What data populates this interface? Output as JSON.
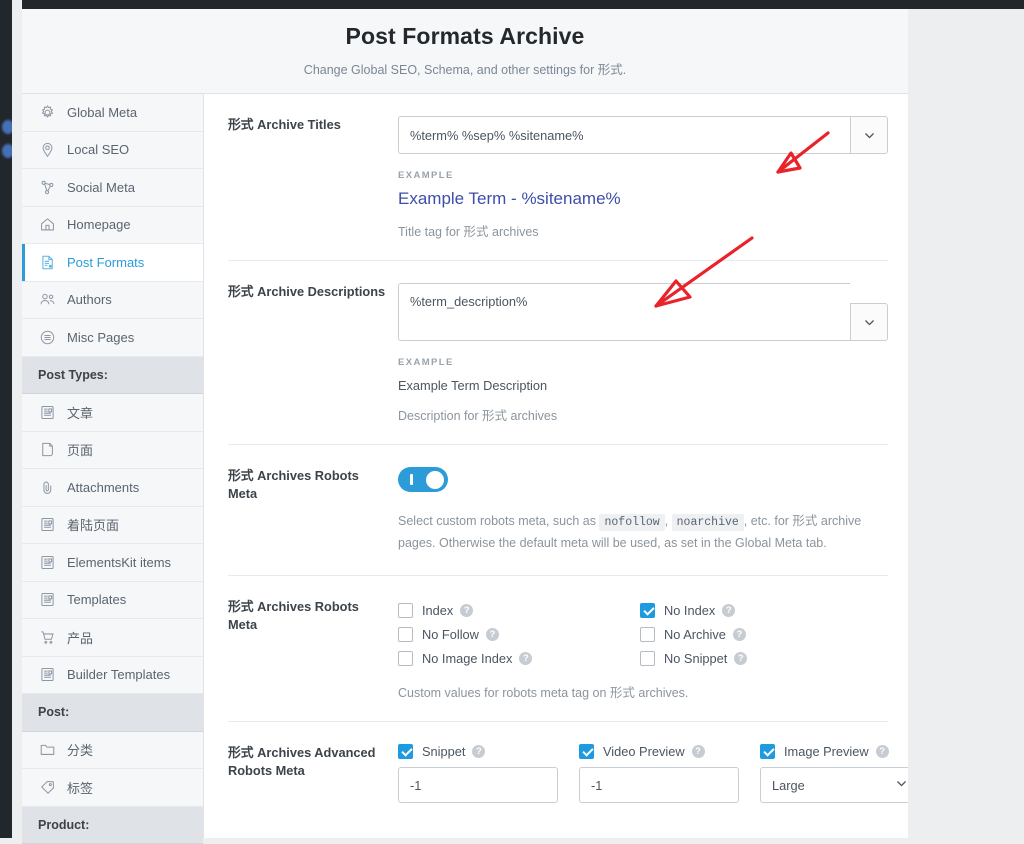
{
  "header": {
    "title": "Post Formats Archive",
    "subtitle": "Change Global SEO, Schema, and other settings for 形式."
  },
  "sidebar": {
    "items": [
      {
        "label": "Global Meta",
        "icon": "gear-icon",
        "type": "item",
        "active": false
      },
      {
        "label": "Local SEO",
        "icon": "map-pin-icon",
        "type": "item",
        "active": false
      },
      {
        "label": "Social Meta",
        "icon": "share-icon",
        "type": "item",
        "active": false
      },
      {
        "label": "Homepage",
        "icon": "home-icon",
        "type": "item",
        "active": false
      },
      {
        "label": "Post Formats",
        "icon": "document-icon",
        "type": "item",
        "active": true
      },
      {
        "label": "Authors",
        "icon": "users-icon",
        "type": "item",
        "active": false
      },
      {
        "label": "Misc Pages",
        "icon": "list-circle-icon",
        "type": "item",
        "active": false
      },
      {
        "label": "Post Types:",
        "icon": "",
        "type": "group",
        "active": false
      },
      {
        "label": "文章",
        "icon": "article-icon",
        "type": "item",
        "active": false
      },
      {
        "label": "页面",
        "icon": "page-icon",
        "type": "item",
        "active": false
      },
      {
        "label": "Attachments",
        "icon": "paperclip-icon",
        "type": "item",
        "active": false
      },
      {
        "label": "着陆页面",
        "icon": "article-icon",
        "type": "item",
        "active": false
      },
      {
        "label": "ElementsKit items",
        "icon": "article-icon",
        "type": "item",
        "active": false
      },
      {
        "label": "Templates",
        "icon": "article-icon",
        "type": "item",
        "active": false
      },
      {
        "label": "产品",
        "icon": "cart-icon",
        "type": "item",
        "active": false
      },
      {
        "label": "Builder Templates",
        "icon": "article-icon",
        "type": "item",
        "active": false
      },
      {
        "label": "Post:",
        "icon": "",
        "type": "group",
        "active": false
      },
      {
        "label": "分类",
        "icon": "folder-icon",
        "type": "item",
        "active": false
      },
      {
        "label": "标签",
        "icon": "tag-icon",
        "type": "item",
        "active": false
      },
      {
        "label": "Product:",
        "icon": "",
        "type": "group",
        "active": false
      }
    ]
  },
  "main": {
    "archive_titles": {
      "label": "形式 Archive Titles",
      "value": "%term% %sep% %sitename%",
      "example_label": "EXAMPLE",
      "example_value": "Example Term - %sitename%",
      "hint": "Title tag for 形式 archives",
      "caret": "chevron-down-icon"
    },
    "archive_descriptions": {
      "label": "形式 Archive Descriptions",
      "value": "%term_description%",
      "example_label": "EXAMPLE",
      "example_value": "Example Term Description",
      "hint": "Description for 形式 archives",
      "caret": "chevron-down-icon"
    },
    "robots_meta_toggle": {
      "label": "形式 Archives Robots Meta",
      "enabled": true,
      "help_part1": "Select custom robots meta, such as ",
      "help_code1": "nofollow",
      "help_sep": ", ",
      "help_code2": "noarchive",
      "help_part2": ", etc. for 形式 archive pages. Otherwise the default meta will be used, as set in the Global Meta tab."
    },
    "robots_meta_checkboxes": {
      "label": "形式 Archives Robots Meta",
      "column_left": [
        {
          "label": "Index",
          "checked": false
        },
        {
          "label": "No Follow",
          "checked": false
        },
        {
          "label": "No Image Index",
          "checked": false
        }
      ],
      "column_right": [
        {
          "label": "No Index",
          "checked": true
        },
        {
          "label": "No Archive",
          "checked": false
        },
        {
          "label": "No Snippet",
          "checked": false
        }
      ],
      "hint": "Custom values for robots meta tag on 形式 archives."
    },
    "advanced_robots_meta": {
      "label": "形式 Archives Advanced Robots Meta",
      "columns": [
        {
          "label": "Snippet",
          "checked": true,
          "value": "-1",
          "kind": "input"
        },
        {
          "label": "Video Preview",
          "checked": true,
          "value": "-1",
          "kind": "input"
        },
        {
          "label": "Image Preview",
          "checked": true,
          "value": "Large",
          "kind": "select"
        }
      ]
    },
    "help_icon": "question-mark-icon"
  },
  "annotations": {
    "arrow_1": "red-arrow-pointing-to-archive-titles-field",
    "arrow_2": "red-arrow-pointing-to-archive-descriptions-field",
    "color": "#e8232a"
  }
}
